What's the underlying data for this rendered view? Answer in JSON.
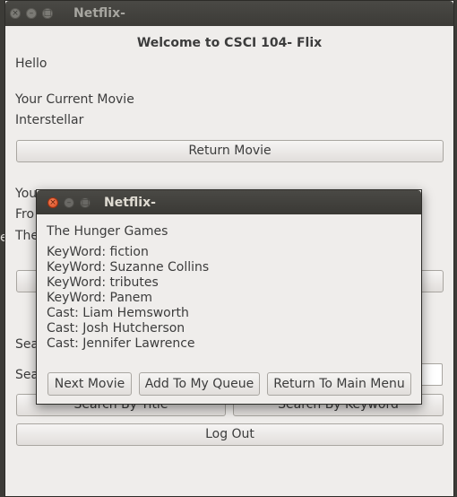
{
  "main_window": {
    "title": "Netflix-",
    "welcome": "Welcome to CSCI 104- Flix",
    "greeting": "Hello",
    "current_movie_label": " Your Current Movie",
    "current_movie_value": "Interstellar",
    "return_movie_button": "Return Movie",
    "partial_you": "You",
    "partial_fro": "Fro",
    "partial_the": "The",
    "partial_sea_1": "Sea",
    "partial_sea_2": "Sea",
    "search_by_title_button": "Search By Title",
    "search_by_keyword_button": "Search By Keyword",
    "logout_button": "Log Out",
    "edge_char": "e"
  },
  "dialog": {
    "title": "Netflix-",
    "movie_title": "The Hunger Games",
    "details": [
      "KeyWord: fiction",
      "KeyWord: Suzanne Collins",
      "KeyWord: tributes",
      "KeyWord: Panem",
      "Cast: Liam Hemsworth",
      "Cast: Josh Hutcherson",
      "Cast: Jennifer Lawrence"
    ],
    "buttons": {
      "next_movie": "Next Movie",
      "add_to_queue": "Add To My Queue",
      "return_main": "Return To Main Menu"
    }
  },
  "icons": {
    "close": "close-icon",
    "minimize": "minimize-icon",
    "maximize": "maximize-icon"
  },
  "colors": {
    "titlebar": "#3c3b37",
    "window_bg": "#efedeb",
    "close_active": "#e05a2b"
  }
}
